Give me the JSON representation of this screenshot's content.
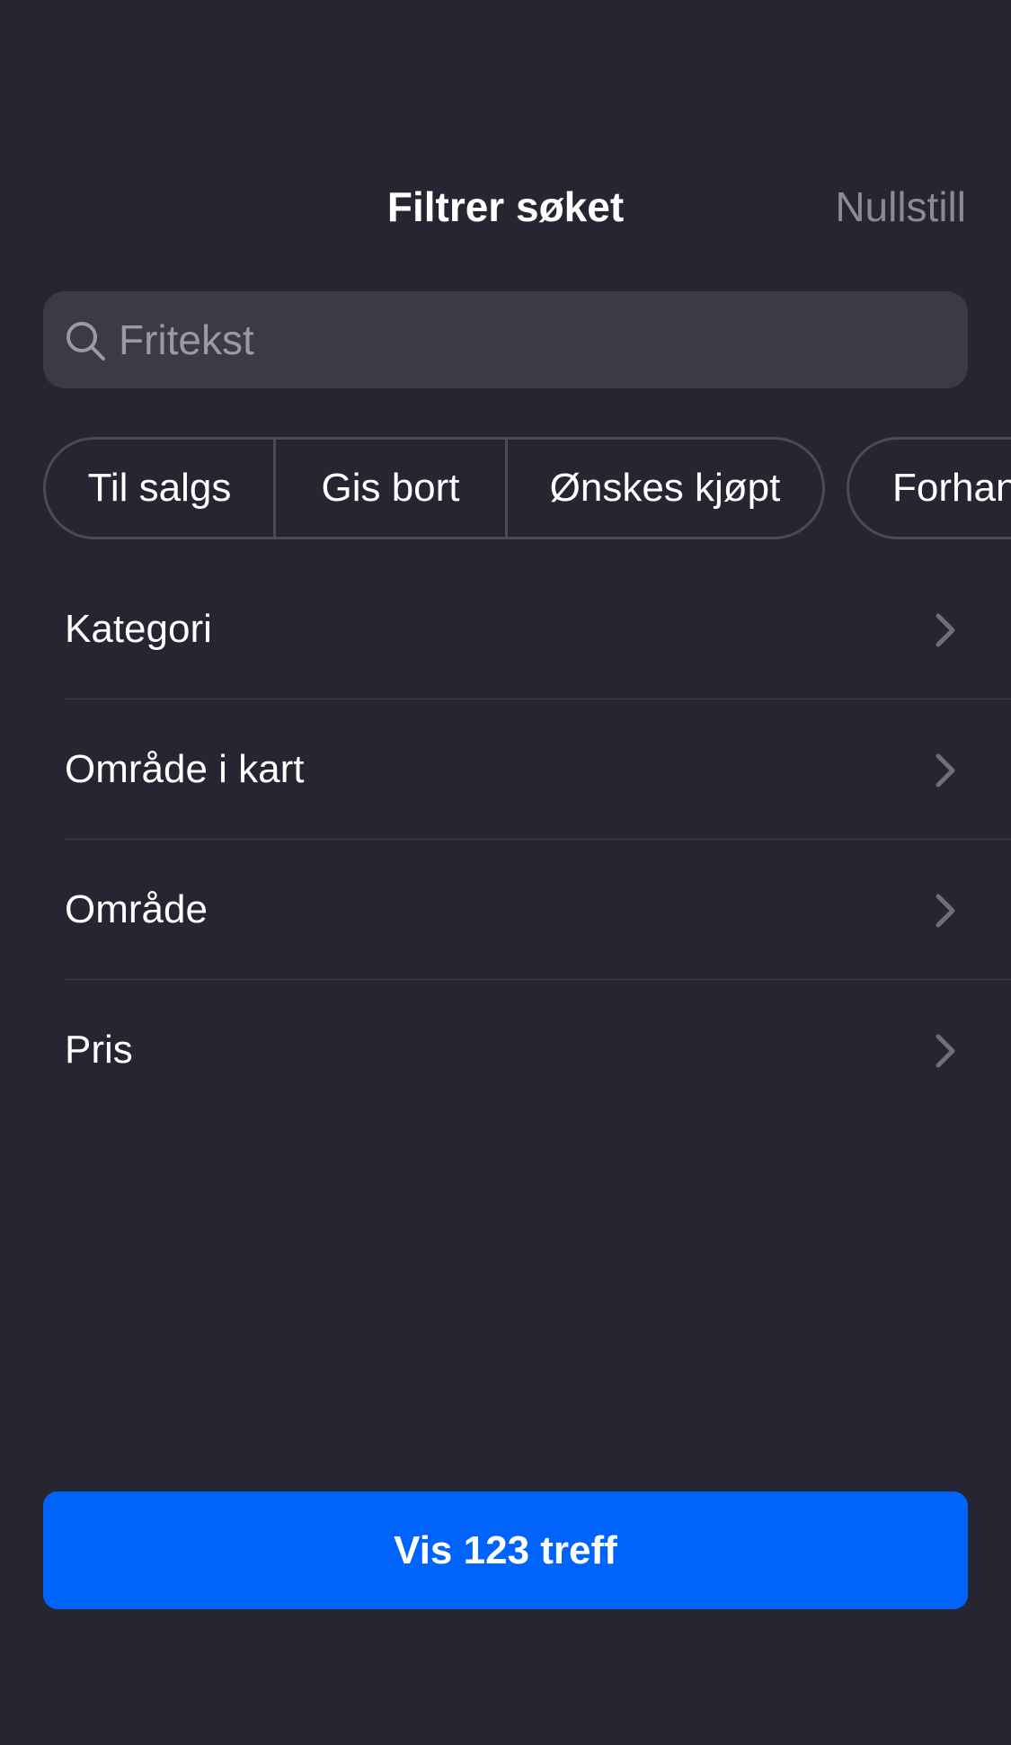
{
  "header": {
    "title": "Filtrer søket",
    "reset_label": "Nullstill"
  },
  "search": {
    "placeholder": "Fritekst",
    "value": ""
  },
  "chips": {
    "segments": [
      {
        "label": "Til salgs"
      },
      {
        "label": "Gis bort"
      },
      {
        "label": "Ønskes kjøpt"
      }
    ],
    "extra": {
      "label": "Forhandler"
    }
  },
  "filters": [
    {
      "label": "Kategori"
    },
    {
      "label": "Område i kart"
    },
    {
      "label": "Område"
    },
    {
      "label": "Pris"
    }
  ],
  "cta": {
    "label": "Vis 123 treff"
  },
  "colors": {
    "background": "#262632",
    "accent": "#0063fb",
    "muted_text": "#8a8a96"
  },
  "icons": {
    "search": "search-icon",
    "chevron": "chevron-right-icon"
  }
}
